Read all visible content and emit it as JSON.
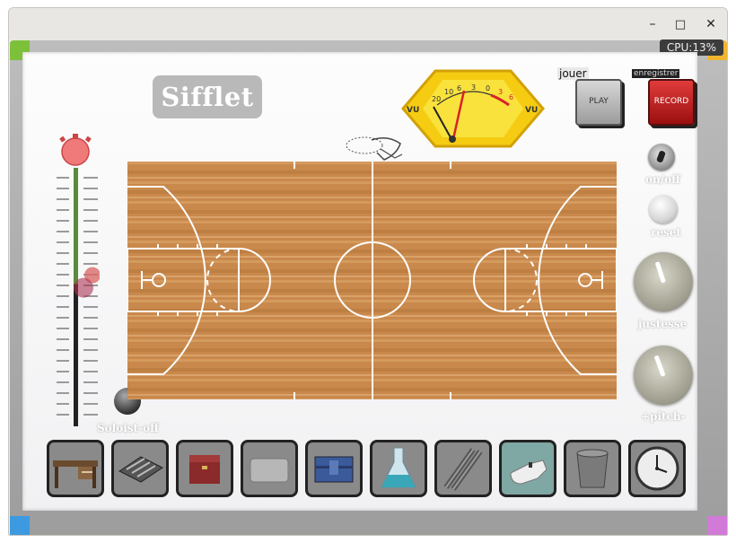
{
  "window": {
    "controls": {
      "minimize": "–",
      "maximize": "□",
      "close": "✕"
    }
  },
  "cpu": "CPU:13%",
  "title": "Sifflet",
  "buttons": {
    "play_caption": "jouer",
    "play_label": "PLAY",
    "record_caption": "enregistrer",
    "record_label": "RECORD"
  },
  "vu_meter": {
    "left_label": "VU",
    "right_label": "VU",
    "scale": [
      "20",
      "10",
      "6",
      "3",
      "0",
      "3",
      "6"
    ]
  },
  "controls": {
    "onoff": "on/off",
    "reset": "reset",
    "justesse": "justesse",
    "pitch": "+pitch-",
    "soloist": "Soloist-off"
  },
  "volume_slider": {
    "level": 0.55
  },
  "shelf": {
    "items": [
      {
        "name": "desk",
        "active": false
      },
      {
        "name": "cutlery-tray",
        "active": false
      },
      {
        "name": "wooden-box",
        "active": false
      },
      {
        "name": "metal-tray",
        "active": false
      },
      {
        "name": "blue-case",
        "active": false
      },
      {
        "name": "flask",
        "active": false
      },
      {
        "name": "metal-rods",
        "active": false
      },
      {
        "name": "whistle",
        "active": true
      },
      {
        "name": "glass",
        "active": false
      },
      {
        "name": "clock",
        "active": false
      }
    ]
  },
  "colors": {
    "accent_red": "#d8222a",
    "vu_yellow": "#f7d21a",
    "wood": "#c88a4e"
  }
}
